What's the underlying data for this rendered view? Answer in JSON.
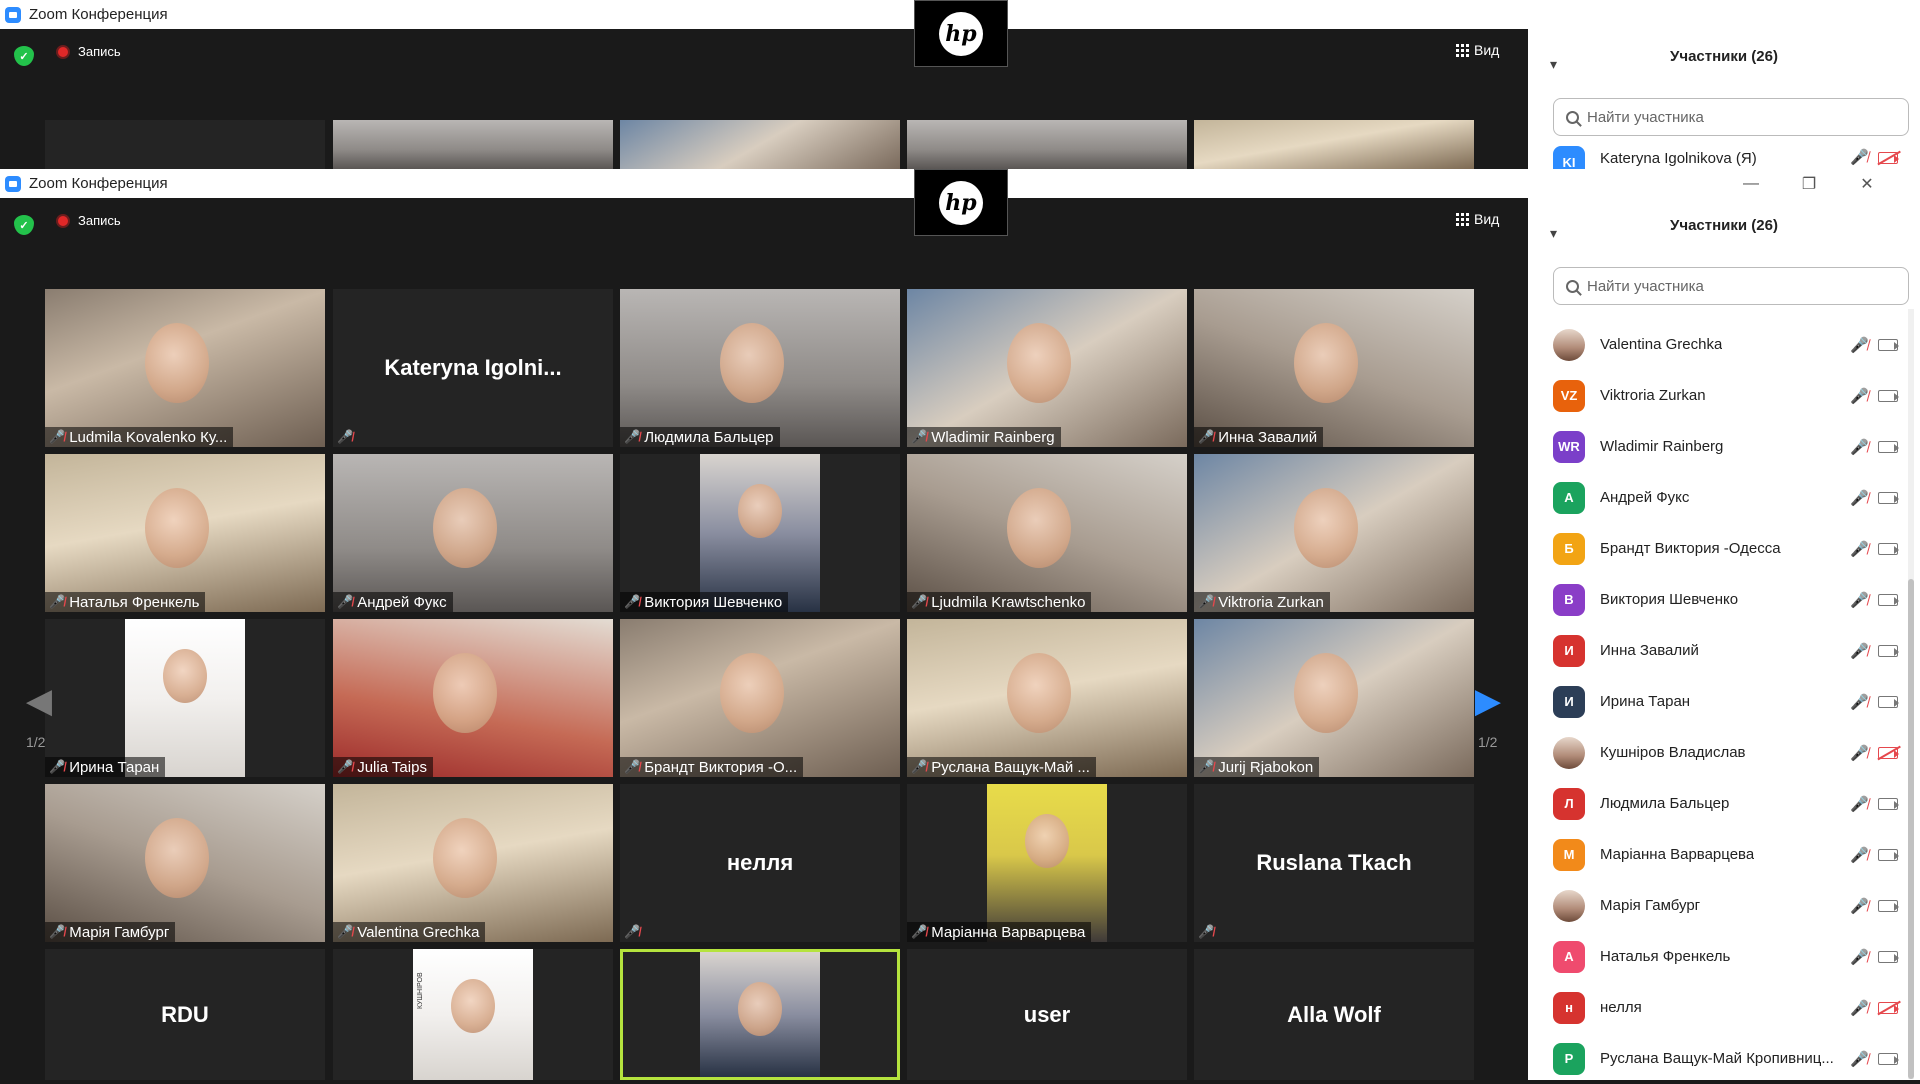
{
  "window": {
    "title": "Zoom Конференция",
    "record_label": "Запись",
    "view_label": "Вид",
    "hp_logo": "hp"
  },
  "participants_panel": {
    "title": "Участники (26)",
    "search_placeholder": "Найти участника",
    "back_row_name": "Kateryna Igolnikova (Я)",
    "back_row_initials": "KI",
    "items": [
      {
        "name": "Valentina Grechka",
        "initials": "",
        "color": "",
        "photo": true,
        "cam_off": false
      },
      {
        "name": "Viktroria Zurkan",
        "initials": "VZ",
        "color": "#e8620c",
        "photo": false,
        "cam_off": false
      },
      {
        "name": "Wladimir Rainberg",
        "initials": "WR",
        "color": "#7b3fc9",
        "photo": false,
        "cam_off": false
      },
      {
        "name": "Андрей Фукс",
        "initials": "А",
        "color": "#1ba35e",
        "photo": false,
        "cam_off": false
      },
      {
        "name": "Брандт  Виктория -Одесса",
        "initials": "Б",
        "color": "#f2a414",
        "photo": false,
        "cam_off": false
      },
      {
        "name": "Виктория Шевченко",
        "initials": "В",
        "color": "#8a3dc7",
        "photo": false,
        "cam_off": false
      },
      {
        "name": "Инна Завалий",
        "initials": "И",
        "color": "#d6332f",
        "photo": false,
        "cam_off": false
      },
      {
        "name": "Ирина Таран",
        "initials": "И",
        "color": "#2c3e57",
        "photo": false,
        "cam_off": false
      },
      {
        "name": "Кушніров Владислав",
        "initials": "",
        "color": "",
        "photo": true,
        "cam_off": true
      },
      {
        "name": "Людмила Бальцер",
        "initials": "Л",
        "color": "#d6332f",
        "photo": false,
        "cam_off": false
      },
      {
        "name": "Маріанна Варварцева",
        "initials": "М",
        "color": "#f28a1a",
        "photo": false,
        "cam_off": false
      },
      {
        "name": "Марія Гамбург",
        "initials": "",
        "color": "",
        "photo": true,
        "cam_off": false
      },
      {
        "name": "Наталья Френкель",
        "initials": "А",
        "color": "#ef4b6e",
        "photo": false,
        "cam_off": false
      },
      {
        "name": "нелля",
        "initials": "н",
        "color": "#d6332f",
        "photo": false,
        "cam_off": true
      },
      {
        "name": "Руслана Ващук-Май Кропивниц...",
        "initials": "Р",
        "color": "#1ba35e",
        "photo": false,
        "cam_off": false
      }
    ]
  },
  "gallery": {
    "page_indicator": "1/2",
    "tiles": [
      {
        "name": "Ludmila Kovalenko Ку...",
        "kind": "video",
        "style": "v1"
      },
      {
        "name": "",
        "kind": "name",
        "big": "Kateryna  Igolni..."
      },
      {
        "name": "Людмила Бальцер",
        "kind": "video",
        "style": "v3"
      },
      {
        "name": "Wladimir Rainberg",
        "kind": "video",
        "style": "v4"
      },
      {
        "name": "Инна Завалий",
        "kind": "video",
        "style": "v2"
      },
      {
        "name": "Наталья Френкель",
        "kind": "video",
        "style": "v5"
      },
      {
        "name": "Андрей Фукс",
        "kind": "video",
        "style": "v3"
      },
      {
        "name": "Виктория Шевченко",
        "kind": "portrait",
        "style": "blue"
      },
      {
        "name": "Ljudmila Krawtschenko",
        "kind": "video",
        "style": "v2"
      },
      {
        "name": "Viktroria Zurkan",
        "kind": "video",
        "style": "v4"
      },
      {
        "name": "Ирина Таран",
        "kind": "portrait",
        "style": "white"
      },
      {
        "name": "Julia Taips",
        "kind": "video",
        "style": "v6"
      },
      {
        "name": "Брандт  Виктория -О...",
        "kind": "video",
        "style": "v1"
      },
      {
        "name": "Руслана Ващук-Май ...",
        "kind": "video",
        "style": "v5"
      },
      {
        "name": "Jurij Rjabokon",
        "kind": "video",
        "style": "v4"
      },
      {
        "name": "Марія Гамбург",
        "kind": "video",
        "style": "v2"
      },
      {
        "name": "Valentina Grechka",
        "kind": "video",
        "style": "v5"
      },
      {
        "name": "",
        "kind": "name",
        "big": "нелля"
      },
      {
        "name": "Маріанна Варварцева",
        "kind": "portrait",
        "style": "yellow"
      },
      {
        "name": "",
        "kind": "name",
        "big": "Ruslana Tkach"
      },
      {
        "name": "",
        "kind": "name",
        "big": "RDU",
        "no_mic": true
      },
      {
        "name": "",
        "kind": "portrait",
        "style": "white",
        "no_mic": true,
        "caption": "КУШНІРОВ"
      },
      {
        "name": "",
        "kind": "portrait",
        "style": "blue",
        "no_mic": true,
        "active": true
      },
      {
        "name": "",
        "kind": "name",
        "big": "user",
        "no_mic": true
      },
      {
        "name": "",
        "kind": "name",
        "big": "Alla Wolf",
        "no_mic": true
      }
    ],
    "top_strip_styles": [
      "dark",
      "v3",
      "v4",
      "v3",
      "v5"
    ]
  },
  "colors": {
    "accent": "#2d8cff",
    "mute_red": "#e5484d",
    "active_border": "#b5e33e",
    "secure_green": "#23c24b",
    "record_red": "#e02828"
  }
}
